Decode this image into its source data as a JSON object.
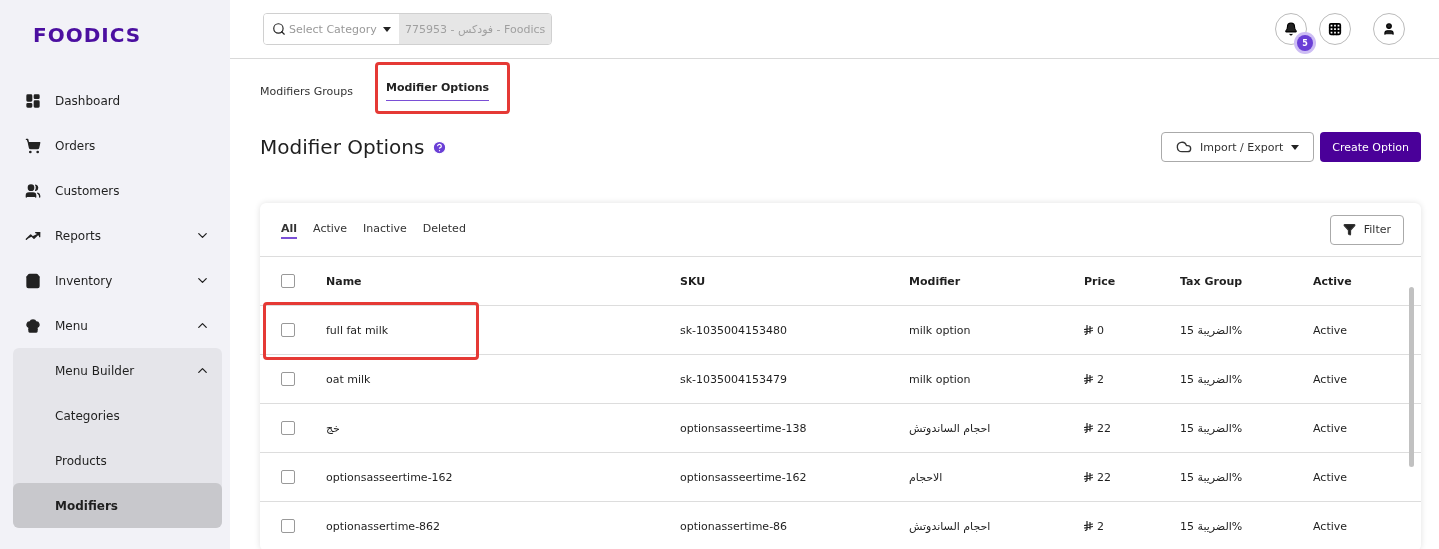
{
  "logo": "FOODICS",
  "sidebar": {
    "items": [
      {
        "label": "Dashboard",
        "selected": false
      },
      {
        "label": "Orders",
        "selected": false
      },
      {
        "label": "Customers",
        "selected": false
      },
      {
        "label": "Reports",
        "selected": false,
        "expanded": false
      },
      {
        "label": "Inventory",
        "selected": false,
        "expanded": false
      },
      {
        "label": "Menu",
        "selected": false,
        "expanded": true,
        "children": [
          {
            "label": "Menu Builder",
            "selected": false,
            "expanded": true,
            "children": [
              {
                "label": "Categories",
                "selected": false
              },
              {
                "label": "Products",
                "selected": false
              },
              {
                "label": "Modifiers",
                "selected": true
              }
            ]
          }
        ]
      }
    ]
  },
  "topbar": {
    "category_search": {
      "placeholder": "Select Category"
    },
    "business_field": {
      "value": "775953 - فودكس - Foodics"
    },
    "notifications_badge": "5"
  },
  "tabs": [
    {
      "label": "Modifiers Groups",
      "selected": false,
      "highlighted": false
    },
    {
      "label": "Modifier Options",
      "selected": true,
      "highlighted": true
    }
  ],
  "page_title": "Modifier Options",
  "buttons": {
    "import_export": "Import / Export",
    "create": "Create Option"
  },
  "filter_tabs": [
    {
      "label": "All",
      "selected": true
    },
    {
      "label": "Active",
      "selected": false
    },
    {
      "label": "Inactive",
      "selected": false
    },
    {
      "label": "Deleted",
      "selected": false
    }
  ],
  "filter_button": "Filter",
  "table": {
    "columns": [
      "Name",
      "SKU",
      "Modifier",
      "Price",
      "Tax Group",
      "Active"
    ],
    "all_checked": false,
    "rows": [
      {
        "checked": false,
        "highlighted": true,
        "name": "full fat milk",
        "sku": "sk-1035004153480",
        "modifier": "milk option",
        "price": "0",
        "tax_group": "الضريبة 15%",
        "active": "Active"
      },
      {
        "checked": false,
        "highlighted": false,
        "name": "oat milk",
        "sku": "sk-1035004153479",
        "modifier": "milk option",
        "price": "2",
        "tax_group": "الضريبة 15%",
        "active": "Active"
      },
      {
        "checked": false,
        "highlighted": false,
        "name": "خج",
        "sku": "optionsasseertime-138",
        "modifier": "احجام الساندوتش",
        "price": "22",
        "tax_group": "الضريبة 15%",
        "active": "Active"
      },
      {
        "checked": false,
        "highlighted": false,
        "name": "optionsasseertime-162",
        "sku": "optionsasseertime-162",
        "modifier": "الاحجام",
        "price": "22",
        "tax_group": "الضريبة 15%",
        "active": "Active"
      },
      {
        "checked": false,
        "highlighted": false,
        "name": "optionassertime-862",
        "sku": "optionassertime-86",
        "modifier": "احجام الساندوتش",
        "price": "2",
        "tax_group": "الضريبة 15%",
        "active": "Active"
      }
    ]
  }
}
